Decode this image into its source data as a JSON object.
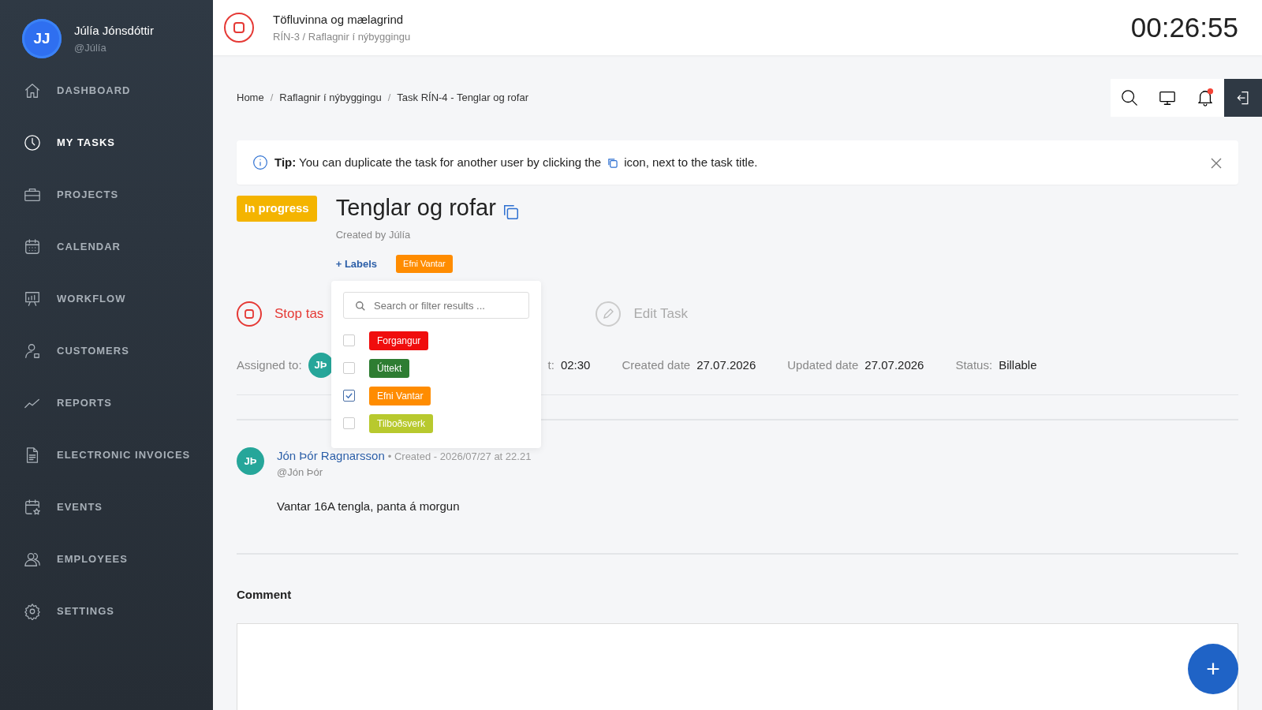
{
  "user": {
    "initials": "JJ",
    "name": "Júlía Jónsdóttir",
    "handle": "@Júlía"
  },
  "sidebar": {
    "items": [
      {
        "label": "DASHBOARD",
        "kind": "home",
        "selected": false
      },
      {
        "label": "MY TASKS",
        "kind": "clock",
        "selected": true
      },
      {
        "label": "PROJECTS",
        "kind": "briefcase",
        "selected": false
      },
      {
        "label": "CALENDAR",
        "kind": "calendar",
        "selected": false
      },
      {
        "label": "WORKFLOW",
        "kind": "board",
        "selected": false
      },
      {
        "label": "CUSTOMERS",
        "kind": "person",
        "selected": false
      },
      {
        "label": "REPORTS",
        "kind": "chart",
        "selected": false
      },
      {
        "label": "ELECTRONIC INVOICES",
        "kind": "document",
        "selected": false
      },
      {
        "label": "EVENTS",
        "kind": "event",
        "selected": false
      },
      {
        "label": "EMPLOYEES",
        "kind": "people",
        "selected": false
      },
      {
        "label": "SETTINGS",
        "kind": "gear",
        "selected": false
      }
    ]
  },
  "header": {
    "task_title": "Töfluvinna og mælagrind",
    "task_path": "RÍN-3 / Raflagnir í nýbyggingu",
    "timer": "00:26:55"
  },
  "breadcrumb": {
    "separator": "/",
    "items": [
      "Home",
      "Raflagnir í nýbyggingu",
      "Task RÍN-4 - Tenglar og rofar"
    ]
  },
  "tip": {
    "text": "**Tip:** You can duplicate the task for another user by clicking the",
    "text_after": "icon, next to the task title."
  },
  "task": {
    "status": "In progress",
    "title": "Tenglar og rofar",
    "created_by": "Created by Júlía",
    "labels_button": "+ Labels",
    "assigned_labels": [
      {
        "name": "Efni Vantar",
        "color": "#ff8c00"
      }
    ],
    "stop_button": "Stop tas",
    "edit_button": "Edit Task"
  },
  "label_menu": {
    "placeholder": "Search or filter results ...",
    "labels": [
      {
        "name": "Forgangur",
        "color": "#f00d0d",
        "checked": false
      },
      {
        "name": "Úttekt",
        "color": "#2e7d32",
        "checked": false
      },
      {
        "name": "Efni Vantar",
        "color": "#ff8c00",
        "checked": true
      },
      {
        "name": "Tilboðsverk",
        "color": "#b8c92e",
        "checked": false
      }
    ]
  },
  "meta": {
    "assigned_label": "Assigned to:",
    "assignee_initials": "JÞ",
    "fields": [
      {
        "label": "t:",
        "value": "02:30"
      },
      {
        "label": "Created date",
        "value": "27.07.2026"
      },
      {
        "label": "Updated date",
        "value": "27.07.2026"
      },
      {
        "label": "Status:",
        "value": "Billable"
      }
    ]
  },
  "comments": [
    {
      "initials": "JÞ",
      "author": "Jón Þór Ragnarsson",
      "created": "• Created - 2026/07/27 at 22.21",
      "handle": "@Jón Þór",
      "body": "Vantar 16A tengla, panta á morgun"
    }
  ],
  "comment_form": {
    "label": "Comment",
    "add_button": "+"
  }
}
